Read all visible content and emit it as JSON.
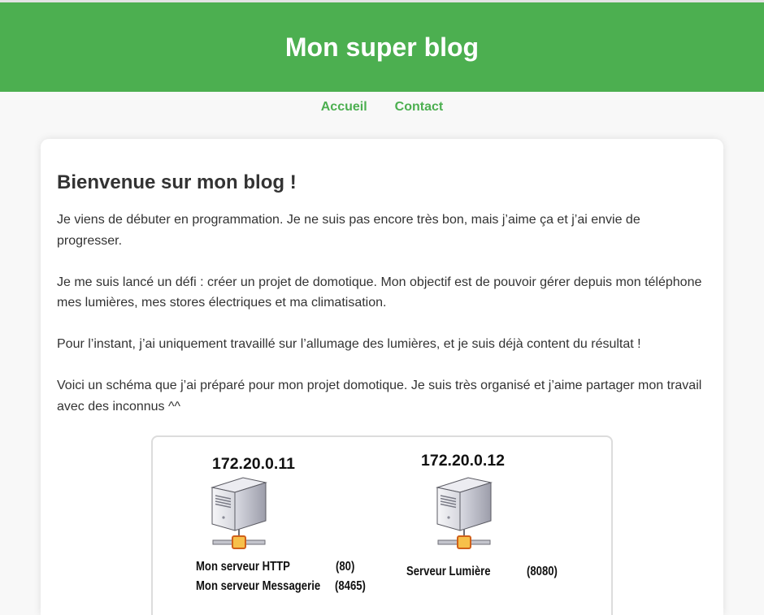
{
  "header": {
    "title": "Mon super blog"
  },
  "nav": {
    "items": [
      {
        "label": "Accueil"
      },
      {
        "label": "Contact"
      }
    ]
  },
  "main": {
    "heading": "Bienvenue sur mon blog !",
    "paragraphs": [
      "Je viens de débuter en programmation. Je ne suis pas encore très bon, mais j’aime ça et j’ai envie de progresser.",
      "Je me suis lancé un défi : créer un projet de domotique. Mon objectif est de pouvoir gérer depuis mon téléphone mes lumières, mes stores électriques et ma climatisation.",
      "Pour l’instant, j’ai uniquement travaillé sur l’allumage des lumières, et je suis déjà content du résultat !",
      "Voici un schéma que j’ai préparé pour mon projet domotique. Je suis très organisé et j’aime partager mon travail avec des inconnus ^^"
    ]
  },
  "diagram": {
    "servers": [
      {
        "ip": "172.20.0.11",
        "icon": "server-icon",
        "services": [
          {
            "name": "Mon serveur HTTP",
            "port": "(80)"
          },
          {
            "name": "Mon serveur Messagerie",
            "port": "(8465)"
          }
        ]
      },
      {
        "ip": "172.20.0.12",
        "icon": "server-icon",
        "services": [
          {
            "name": "Serveur Lumière",
            "port": "(8080)"
          }
        ]
      }
    ]
  },
  "colors": {
    "brand": "#4caf50",
    "background": "#f8f8f8",
    "text": "#333333"
  }
}
